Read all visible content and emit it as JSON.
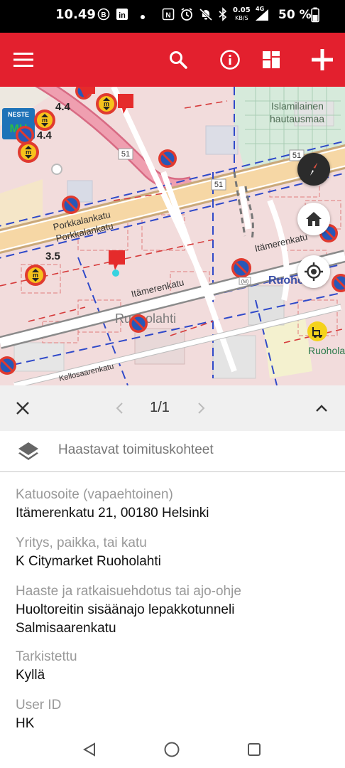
{
  "status_bar": {
    "time": "10.49",
    "network_speed_value": "0.05",
    "network_speed_unit": "KB/S",
    "network_type": "4G",
    "battery": "50 %"
  },
  "toolbar": {
    "menu_icon": "hamburger-menu-icon",
    "search_icon": "search-icon",
    "info_icon": "info-icon",
    "layers_icon": "grid-icon",
    "add_icon": "plus-icon",
    "color": "#e3202e"
  },
  "map": {
    "labels": {
      "porkkalankatu_1": "Porkkalankatu",
      "porkkalankatu_2": "Porkkalankatu",
      "itamerenkatu_1": "Itämerenkatu",
      "itamerenkatu_2": "Itämerenkatu",
      "ruoholahti": "Ruoholahti",
      "ruoho": "Ruoho",
      "ruoholahti_metro": "Ruoholahti",
      "islamic_cemetery_1": "Islamilainen",
      "islamic_cemetery_2": "hautausmaa",
      "kellosaarenkatu": "Kellosaarenkatu",
      "road_51_a": "51",
      "road_51_b": "51",
      "road_51_c": "51",
      "rating_a": "4.4",
      "rating_b": "4.4",
      "rating_c": "3.5",
      "neste": "NESTE",
      "neste_sub": "MH"
    },
    "compass_icon": "compass-icon",
    "home_icon": "home-icon",
    "locate_icon": "my-location-icon"
  },
  "pager": {
    "close_icon": "close-icon",
    "prev_icon": "chevron-left-icon",
    "count": "1/1",
    "next_icon": "chevron-right-icon",
    "collapse_icon": "chevron-up-icon"
  },
  "layer": {
    "icon": "layers-icon",
    "title": "Haastavat toimituskohteet"
  },
  "fields": [
    {
      "label": "Katuosoite (vapaehtoinen)",
      "value": "Itämerenkatu 21, 00180 Helsinki"
    },
    {
      "label": "Yritys, paikka, tai katu",
      "value": "K Citymarket Ruoholahti"
    },
    {
      "label": "Haaste ja ratkaisuehdotus tai ajo-ohje",
      "value": "Huoltoreitin sisäänajo lepakkotunneli Salmisaarenkatu"
    },
    {
      "label": "Tarkistettu",
      "value": "Kyllä"
    },
    {
      "label": "User ID",
      "value": "HK"
    }
  ],
  "navbar": {
    "back_icon": "back-triangle-icon",
    "home_icon": "home-circle-icon",
    "recents_icon": "recents-square-icon"
  }
}
